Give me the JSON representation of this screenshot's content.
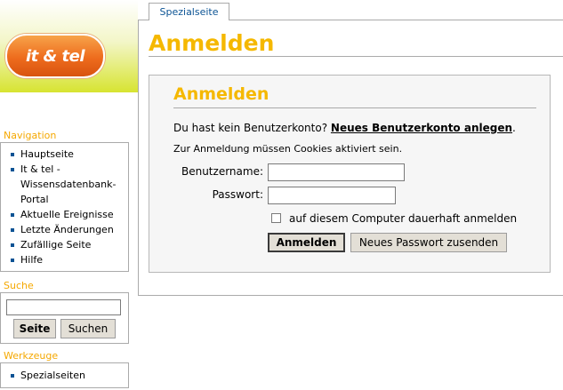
{
  "logo": {
    "text": "it & tel"
  },
  "tab": {
    "label": "Spezialseite"
  },
  "page": {
    "title": "Anmelden"
  },
  "login_form": {
    "legend": "Anmelden",
    "no_account_text": "Du hast kein Benutzerkonto?",
    "create_account_link": "Neues Benutzerkonto anlegen",
    "period": ".",
    "cookies_note": "Zur Anmeldung müssen Cookies aktiviert sein.",
    "username_label": "Benutzername:",
    "username_value": "",
    "password_label": "Passwort:",
    "password_value": "",
    "remember_label": "auf diesem Computer dauerhaft anmelden",
    "remember_checked": false,
    "login_button": "Anmelden",
    "reset_button": "Neues Passwort zusenden"
  },
  "sidebar": {
    "navigation": {
      "title": "Navigation",
      "items": [
        {
          "label": "Hauptseite"
        },
        {
          "label": "It & tel -"
        },
        {
          "label": "Wissensdatenbank-"
        },
        {
          "label": "Portal"
        },
        {
          "label": "Aktuelle Ereignisse"
        },
        {
          "label": "Letzte Änderungen"
        },
        {
          "label": "Zufällige Seite"
        },
        {
          "label": "Hilfe"
        }
      ]
    },
    "search": {
      "title": "Suche",
      "input_value": "",
      "go_button": "Seite",
      "search_button": "Suchen"
    },
    "tools": {
      "title": "Werkzeuge",
      "items": [
        {
          "label": "Spezialseiten"
        }
      ]
    }
  },
  "colors": {
    "accent": "#f5b800",
    "bullet": "#0b5394",
    "button_bg": "#e3dfd6"
  }
}
